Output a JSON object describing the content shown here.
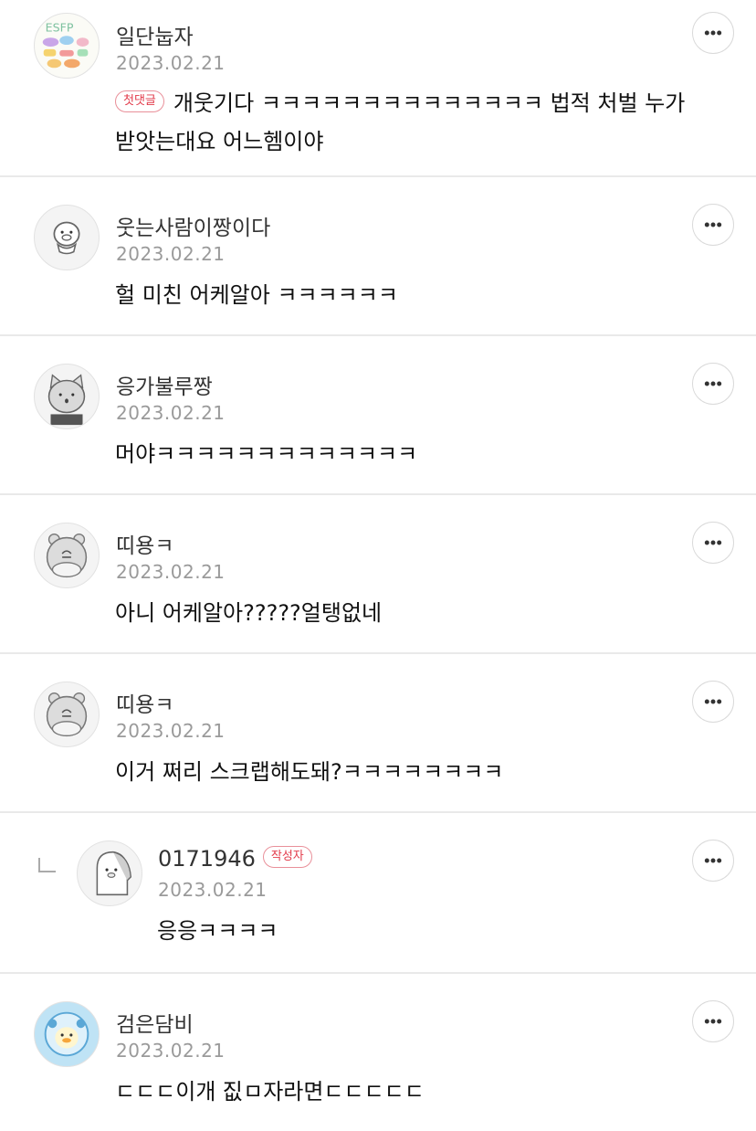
{
  "icons": {
    "more": "more-dots-icon",
    "reply": "reply-arrow-icon"
  },
  "colors": {
    "badge": "#e23a4a",
    "date": "#9a9a9a",
    "divider": "#e9e9e9"
  },
  "comments": [
    {
      "name": "일단눕자",
      "date": "2023.02.21",
      "badge": "첫댓글",
      "line1": "개웃기다 ㅋㅋㅋㅋㅋㅋㅋㅋㅋㅋㅋㅋㅋㅋ 법적 처벌 누가",
      "line2": "받앗는대요 어느헴이야"
    },
    {
      "name": "웃는사람이짱이다",
      "date": "2023.02.21",
      "text": "헐 미친 어케알아 ㅋㅋㅋㅋㅋㅋ"
    },
    {
      "name": "응가불루짱",
      "date": "2023.02.21",
      "text": "머야ㅋㅋㅋㅋㅋㅋㅋㅋㅋㅋㅋㅋㅋ"
    },
    {
      "name": "띠용ㅋ",
      "date": "2023.02.21",
      "text": "아니 어케알아?????얼탱없네"
    },
    {
      "name": "띠용ㅋ",
      "date": "2023.02.21",
      "text": "이거 쩌리 스크랩해도돼?ㅋㅋㅋㅋㅋㅋㅋㅋ"
    },
    {
      "name": "0171946",
      "author_badge": "작성자",
      "date": "2023.02.21",
      "text": "응응ㅋㅋㅋㅋ"
    },
    {
      "name": "검은담비",
      "date": "2023.02.21",
      "text": "ㄷㄷㄷ이개 짒ㅁ자라면ㄷㄷㄷㄷㄷ"
    }
  ]
}
